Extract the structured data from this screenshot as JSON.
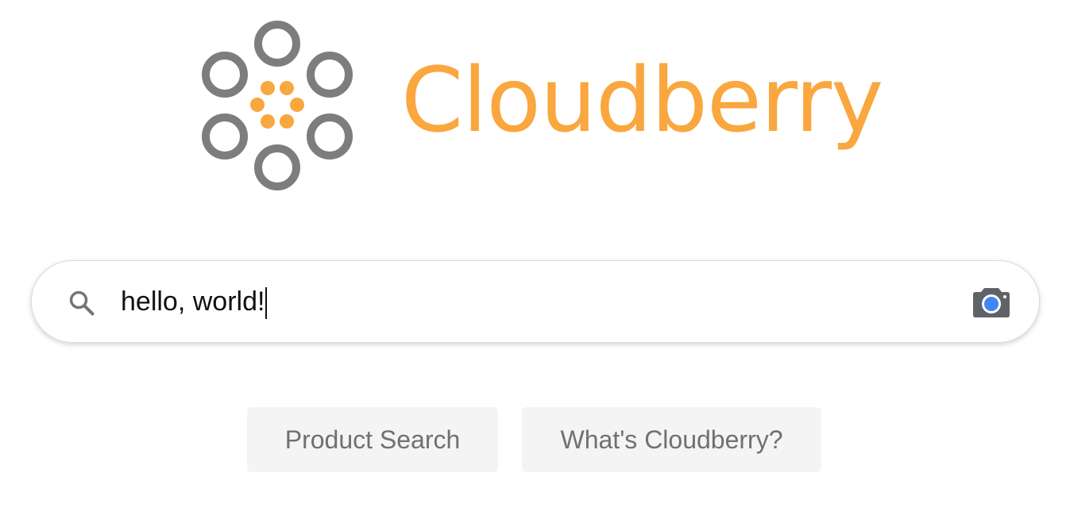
{
  "brand": {
    "name": "Cloudberry",
    "ring_color": "#7d7d7d",
    "dot_color": "#f9a73e",
    "text_color": "#f9a73e"
  },
  "search": {
    "value": "hello, world!",
    "icon": "search-icon",
    "camera_icon": "camera-icon",
    "camera_lens_color": "#4285f4",
    "camera_body_color": "#5f6368"
  },
  "buttons": {
    "product_search": "Product Search",
    "whats_cloudberry": "What's Cloudberry?"
  }
}
